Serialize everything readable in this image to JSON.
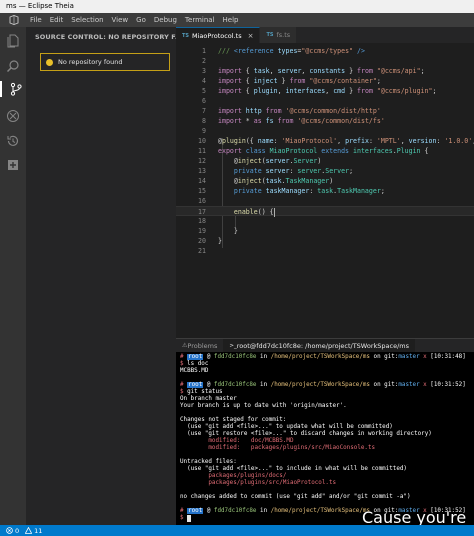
{
  "window": {
    "title": "ms — Eclipse Theia"
  },
  "menu": [
    "File",
    "Edit",
    "Selection",
    "View",
    "Go",
    "Debug",
    "Terminal",
    "Help"
  ],
  "activity_bar": {
    "icons": [
      "explorer-icon",
      "search-icon",
      "source-control-icon",
      "debug-icon",
      "history-icon",
      "extensions-icon"
    ],
    "active": "source-control-icon"
  },
  "sidebar": {
    "title": "SOURCE CONTROL: NO REPOSITORY F...",
    "notice": "No repository found",
    "notice_color": "#c5a017"
  },
  "editor": {
    "tabs": [
      {
        "label": "MiaoProtocol.ts",
        "badge": "TS",
        "active": true,
        "close": "×"
      },
      {
        "label": "fs.ts",
        "badge": "TS",
        "active": false,
        "close": ""
      }
    ],
    "lines": [
      [
        [
          "cm",
          "/// "
        ],
        [
          "k",
          "<reference"
        ],
        [
          "v",
          " types"
        ],
        [
          "p",
          "="
        ],
        [
          "s",
          "\"@ccms/types\""
        ],
        [
          "k",
          " />"
        ]
      ],
      [],
      [
        [
          "c",
          "import"
        ],
        [
          "p",
          " { "
        ],
        [
          "v",
          "task"
        ],
        [
          "p",
          ", "
        ],
        [
          "v",
          "server"
        ],
        [
          "p",
          ", "
        ],
        [
          "v",
          "constants"
        ],
        [
          "p",
          " } "
        ],
        [
          "c",
          "from"
        ],
        [
          "s",
          " \"@ccms/api\""
        ],
        [
          "p",
          ";"
        ]
      ],
      [
        [
          "c",
          "import"
        ],
        [
          "p",
          " { "
        ],
        [
          "v",
          "inject"
        ],
        [
          "p",
          " } "
        ],
        [
          "c",
          "from"
        ],
        [
          "s",
          " \"@ccms/container\""
        ],
        [
          "p",
          ";"
        ]
      ],
      [
        [
          "c",
          "import"
        ],
        [
          "p",
          " { "
        ],
        [
          "v",
          "plugin"
        ],
        [
          "p",
          ", "
        ],
        [
          "v",
          "interfaces"
        ],
        [
          "p",
          ", "
        ],
        [
          "v",
          "cmd"
        ],
        [
          "p",
          " } "
        ],
        [
          "c",
          "from"
        ],
        [
          "s",
          " \"@ccms/plugin\""
        ],
        [
          "p",
          ";"
        ]
      ],
      [],
      [
        [
          "c",
          "import"
        ],
        [
          "v",
          " http"
        ],
        [
          "c",
          " from"
        ],
        [
          "s",
          " '@ccms/common/dist/http'"
        ]
      ],
      [
        [
          "c",
          "import"
        ],
        [
          "p",
          " * "
        ],
        [
          "c",
          "as"
        ],
        [
          "v",
          " fs"
        ],
        [
          "c",
          " from"
        ],
        [
          "s",
          " '@ccms/common/dist/fs'"
        ]
      ],
      [],
      [
        [
          "p",
          "@"
        ],
        [
          "f",
          "plugin"
        ],
        [
          "p",
          "({ "
        ],
        [
          "v",
          "name"
        ],
        [
          "p",
          ": "
        ],
        [
          "s",
          "'MiaoProtocol'"
        ],
        [
          "p",
          ", "
        ],
        [
          "v",
          "prefix"
        ],
        [
          "p",
          ": "
        ],
        [
          "s",
          "'MPTL'"
        ],
        [
          "p",
          ", "
        ],
        [
          "v",
          "version"
        ],
        [
          "p",
          ": "
        ],
        [
          "s",
          "'1.0.0'"
        ],
        [
          "p",
          ", a"
        ]
      ],
      [
        [
          "c",
          "export"
        ],
        [
          "k",
          " class"
        ],
        [
          "t",
          " MiaoProtocol"
        ],
        [
          "k",
          " extends"
        ],
        [
          "t",
          " interfaces"
        ],
        [
          "p",
          "."
        ],
        [
          "t",
          "Plugin"
        ],
        [
          "p",
          " {"
        ]
      ],
      [
        [
          "p",
          "    @"
        ],
        [
          "f",
          "inject"
        ],
        [
          "p",
          "("
        ],
        [
          "v",
          "server"
        ],
        [
          "p",
          "."
        ],
        [
          "t",
          "Server"
        ],
        [
          "p",
          ")"
        ]
      ],
      [
        [
          "k",
          "    private"
        ],
        [
          "v",
          " server"
        ],
        [
          "p",
          ": "
        ],
        [
          "t",
          "server"
        ],
        [
          "p",
          "."
        ],
        [
          "t",
          "Server"
        ],
        [
          "p",
          ";"
        ]
      ],
      [
        [
          "p",
          "    @"
        ],
        [
          "f",
          "inject"
        ],
        [
          "p",
          "("
        ],
        [
          "v",
          "task"
        ],
        [
          "p",
          "."
        ],
        [
          "t",
          "TaskManager"
        ],
        [
          "p",
          ")"
        ]
      ],
      [
        [
          "k",
          "    private"
        ],
        [
          "v",
          " taskManager"
        ],
        [
          "p",
          ": "
        ],
        [
          "t",
          "task"
        ],
        [
          "p",
          "."
        ],
        [
          "t",
          "TaskManager"
        ],
        [
          "p",
          ";"
        ]
      ],
      [],
      [
        [
          "p",
          "    "
        ],
        [
          "f",
          "enable"
        ],
        [
          "p",
          "() {"
        ]
      ],
      [],
      [
        [
          "p",
          "    }"
        ]
      ],
      [
        [
          "p",
          "}"
        ]
      ],
      []
    ]
  },
  "panel": {
    "tabs": [
      {
        "label": "Problems",
        "active": false
      },
      {
        "label": "root@fdd7dc10fc8e: /home/project/TSWorkSpace/ms",
        "active": true
      }
    ]
  },
  "terminal": {
    "lines": [
      [
        [
          "tr",
          "# "
        ],
        [
          "badge",
          "root"
        ],
        [
          "tw",
          " @ "
        ],
        [
          "tg",
          "fdd7dc10fc8e"
        ],
        [
          "tw",
          " in "
        ],
        [
          "ty",
          "/home/project/TSWorkSpace/ms"
        ],
        [
          "tw",
          " on git:"
        ],
        [
          "tb",
          "master"
        ],
        [
          "tr",
          " x"
        ],
        [
          "tw",
          " [10:31:48]"
        ]
      ],
      [
        [
          "tr",
          "$ "
        ],
        [
          "tw",
          "ls doc"
        ]
      ],
      [
        [
          "tw",
          "MCBBS.MD"
        ]
      ],
      [],
      [
        [
          "tr",
          "# "
        ],
        [
          "badge",
          "root"
        ],
        [
          "tw",
          " @ "
        ],
        [
          "tg",
          "fdd7dc10fc8e"
        ],
        [
          "tw",
          " in "
        ],
        [
          "ty",
          "/home/project/TSWorkSpace/ms"
        ],
        [
          "tw",
          " on git:"
        ],
        [
          "tb",
          "master"
        ],
        [
          "tr",
          " x"
        ],
        [
          "tw",
          " [10:31:52]"
        ]
      ],
      [
        [
          "tr",
          "$ "
        ],
        [
          "tw",
          "git status"
        ]
      ],
      [
        [
          "tw",
          "On branch master"
        ]
      ],
      [
        [
          "tw",
          "Your branch is up to date with 'origin/master'."
        ]
      ],
      [],
      [
        [
          "tw",
          "Changes not staged for commit:"
        ]
      ],
      [
        [
          "tw",
          "  (use \"git add <file>...\" to update what will be committed)"
        ]
      ],
      [
        [
          "tw",
          "  (use \"git restore <file>...\" to discard changes in working directory)"
        ]
      ],
      [
        [
          "tr",
          "        modified:   doc/MCBBS.MD"
        ]
      ],
      [
        [
          "tr",
          "        modified:   packages/plugins/src/MiaoConsole.ts"
        ]
      ],
      [],
      [
        [
          "tw",
          "Untracked files:"
        ]
      ],
      [
        [
          "tw",
          "  (use \"git add <file>...\" to include in what will be committed)"
        ]
      ],
      [
        [
          "tr",
          "        packages/plugins/docs/"
        ]
      ],
      [
        [
          "tr",
          "        packages/plugins/src/MiaoProtocol.ts"
        ]
      ],
      [],
      [
        [
          "tw",
          "no changes added to commit (use \"git add\" and/or \"git commit -a\")"
        ]
      ],
      [],
      [
        [
          "tr",
          "# "
        ],
        [
          "badge",
          "root"
        ],
        [
          "tw",
          " @ "
        ],
        [
          "tg",
          "fdd7dc10fc8e"
        ],
        [
          "tw",
          " in "
        ],
        [
          "ty",
          "/home/project/TSWorkSpace/ms"
        ],
        [
          "tw",
          " on git:"
        ],
        [
          "tb",
          "master"
        ],
        [
          "tr",
          " x"
        ],
        [
          "tw",
          " [10:31:52]"
        ]
      ],
      [
        [
          "tr",
          "$ "
        ],
        [
          "cursor",
          ""
        ]
      ]
    ],
    "caption": "Cause you're"
  },
  "statusbar": {
    "errors": "0",
    "warnings": "11",
    "color": "#007acc"
  }
}
